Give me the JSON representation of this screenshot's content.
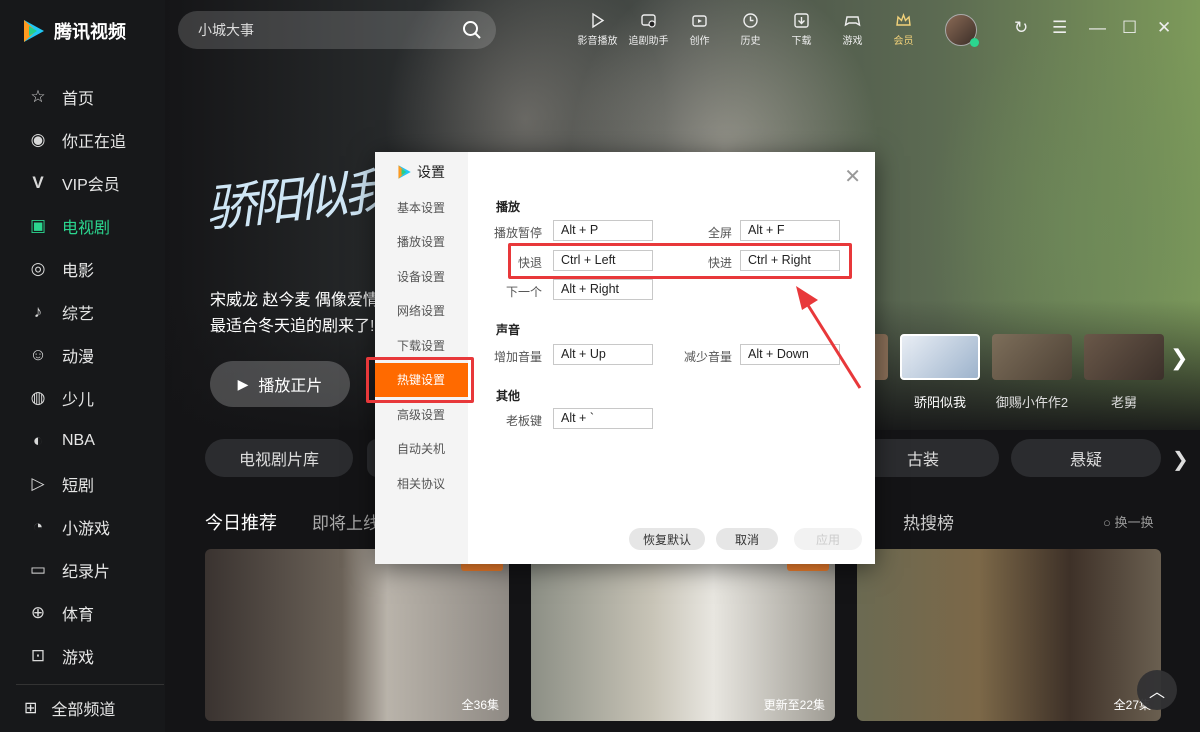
{
  "app": {
    "name": "腾讯视频"
  },
  "sidebar": {
    "items": [
      {
        "label": "首页",
        "icon": "star-icon"
      },
      {
        "label": "你正在追",
        "icon": "eye-icon"
      },
      {
        "label": "VIP会员",
        "icon": "vip-icon"
      },
      {
        "label": "电视剧",
        "icon": "tv-icon",
        "active": true
      },
      {
        "label": "电影",
        "icon": "film-icon"
      },
      {
        "label": "综艺",
        "icon": "variety-icon"
      },
      {
        "label": "动漫",
        "icon": "anime-icon"
      },
      {
        "label": "少儿",
        "icon": "kids-icon"
      },
      {
        "label": "NBA",
        "icon": "nba-icon"
      },
      {
        "label": "短剧",
        "icon": "short-drama-icon"
      },
      {
        "label": "小游戏",
        "icon": "minigame-icon"
      },
      {
        "label": "纪录片",
        "icon": "documentary-icon"
      },
      {
        "label": "体育",
        "icon": "sports-icon"
      },
      {
        "label": "游戏",
        "icon": "game-icon"
      }
    ],
    "all_channels": "全部频道"
  },
  "search": {
    "placeholder": "小城大事"
  },
  "toolbar": [
    {
      "label": "影音播放",
      "icon": "play-icon"
    },
    {
      "label": "追剧助手",
      "icon": "assistant-icon"
    },
    {
      "label": "创作",
      "icon": "create-icon"
    },
    {
      "label": "历史",
      "icon": "history-icon"
    },
    {
      "label": "下载",
      "icon": "download-icon"
    },
    {
      "label": "游戏",
      "icon": "gamepad-icon"
    },
    {
      "label": "会员",
      "icon": "vip-crown-icon"
    }
  ],
  "hero": {
    "title_art": "骄阳似我",
    "desc_line1": "宋威龙 赵今麦 偶像爱情",
    "desc_line2": "最适合冬天追的剧来了!",
    "play_label": "播放正片",
    "thumbs": [
      {
        "label": "",
        "color": "#8a6f58"
      },
      {
        "label": "骄阳似我",
        "color": "#c9d6e6",
        "selected": true
      },
      {
        "label": "御赐小仵作2",
        "color": "#6d6150"
      },
      {
        "label": "老舅",
        "color": "#5a4a3e"
      }
    ]
  },
  "categories": [
    "电视剧片库",
    "",
    "古装",
    "悬疑"
  ],
  "recommend": {
    "title": "今日推荐",
    "tab2": "即将上线",
    "hot": "热搜榜",
    "refresh": "换一换",
    "cards": [
      {
        "episodes": "全36集"
      },
      {
        "episodes": "更新至22集"
      },
      {
        "episodes": "全27集"
      }
    ]
  },
  "settings": {
    "title": "设置",
    "menu": [
      "基本设置",
      "播放设置",
      "设备设置",
      "网络设置",
      "下载设置",
      "热键设置",
      "高级设置",
      "自动关机",
      "相关协议"
    ],
    "active_menu": "热键设置",
    "sections": {
      "play": "播放",
      "sound": "声音",
      "other": "其他"
    },
    "hotkeys": {
      "play_pause": {
        "label": "播放暂停",
        "value": "Alt + P"
      },
      "fullscreen": {
        "label": "全屏",
        "value": "Alt + F"
      },
      "rewind": {
        "label": "快退",
        "value": "Ctrl + Left"
      },
      "forward": {
        "label": "快进",
        "value": "Ctrl + Right"
      },
      "next": {
        "label": "下一个",
        "value": "Alt + Right"
      },
      "vol_up": {
        "label": "增加音量",
        "value": "Alt + Up"
      },
      "vol_down": {
        "label": "减少音量",
        "value": "Alt + Down"
      },
      "boss_key": {
        "label": "老板键",
        "value": "Alt + `"
      }
    },
    "buttons": {
      "restore": "恢复默认",
      "cancel": "取消",
      "apply": "应用"
    }
  },
  "colors": {
    "accent": "#2bd68f",
    "active_menu": "#ff6a00",
    "highlight": "#e8383a"
  }
}
